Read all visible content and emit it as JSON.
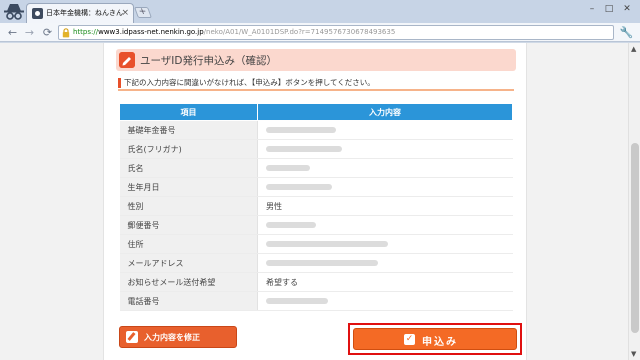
{
  "browser": {
    "tab_title": "日本年金機構：ねんきんネット",
    "tab_close": "×",
    "new_tab": "+",
    "window_controls": {
      "minimize": "–",
      "maximize": "□",
      "close": "✕"
    },
    "nav": {
      "back": "←",
      "forward": "→",
      "reload": "⟳"
    },
    "url": {
      "scheme": "https://",
      "host": "www3.idpass-net.nenkin.go.jp",
      "path": "/neko/A01/W_A0101DSP.do?r=7149576730678493635"
    },
    "menu_icon": "wrench-icon",
    "menu_glyph": "🔧"
  },
  "page": {
    "heading": "ユーザID発行申込み（確認）",
    "notice": "下記の入力内容に間違いがなければ、【申込み】ボタンを押してください。",
    "table": {
      "headers": [
        "項目",
        "入力内容"
      ],
      "rows": [
        {
          "label": "基礎年金番号",
          "value": ""
        },
        {
          "label": "氏名(フリガナ)",
          "value": ""
        },
        {
          "label": "氏名",
          "value": ""
        },
        {
          "label": "生年月日",
          "value": ""
        },
        {
          "label": "性別",
          "value": "男性"
        },
        {
          "label": "郵便番号",
          "value": ""
        },
        {
          "label": "住所",
          "value": ""
        },
        {
          "label": "メールアドレス",
          "value": ""
        },
        {
          "label": "お知らせメール送付希望",
          "value": "希望する"
        },
        {
          "label": "電話番号",
          "value": ""
        }
      ]
    },
    "edit_button": "入力内容を修正",
    "submit_button": "申込み",
    "colors": {
      "accent": "#f46a25",
      "header_blue": "#2b95d9",
      "heading_bg": "#fbd8ce",
      "highlight": "#e01010"
    }
  }
}
